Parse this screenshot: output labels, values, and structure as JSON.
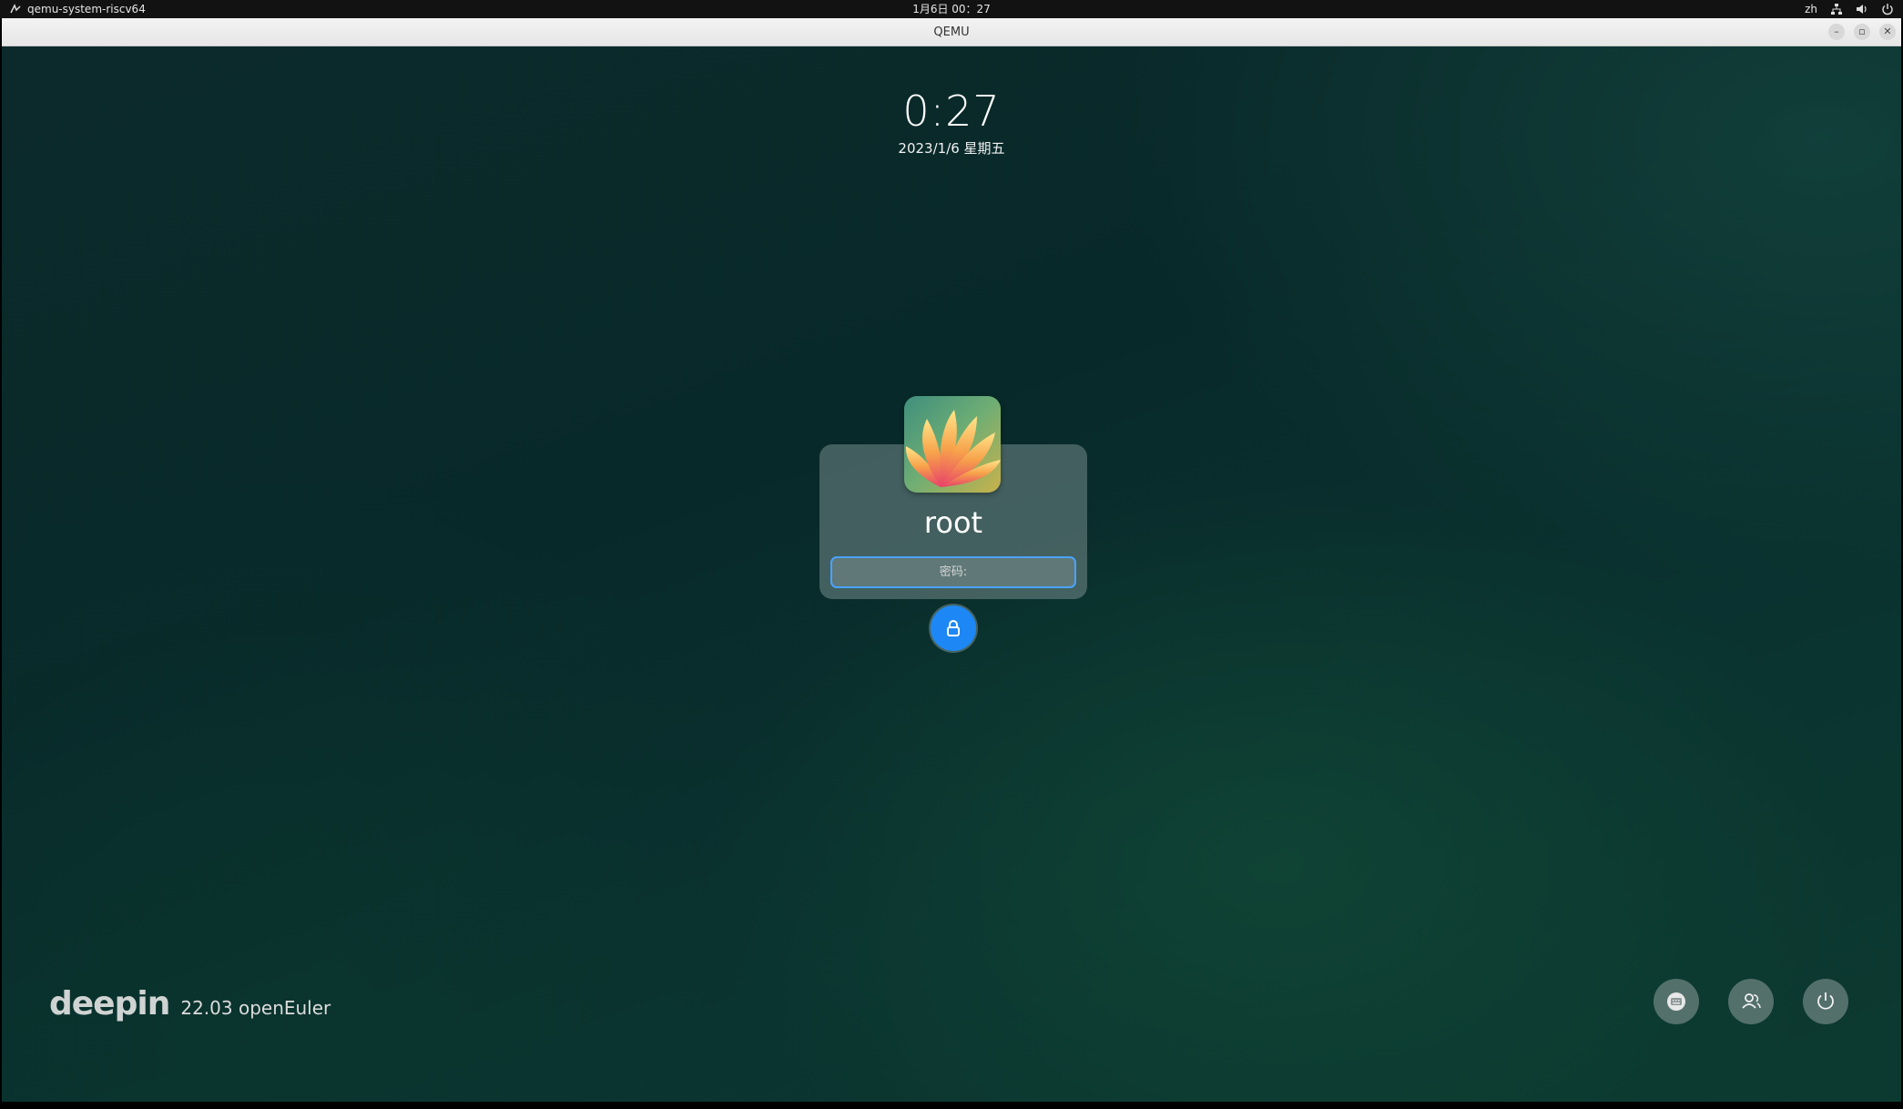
{
  "topbar": {
    "app_name": "qemu-system-riscv64",
    "clock": "1月6日  00：27",
    "language": "zh"
  },
  "window": {
    "title": "QEMU",
    "minimize_label": "–",
    "restore_label": "▫",
    "close_label": "✕"
  },
  "lockscreen": {
    "time": "0:27",
    "date": "2023/1/6 星期五",
    "username": "root",
    "password_placeholder": "密码:",
    "accent_color": "#1d88f5"
  },
  "brand": {
    "logo": "deepin",
    "version": "22.03 openEuler"
  },
  "icons": {
    "app": "qemu-icon",
    "tray": [
      "network-icon",
      "volume-icon",
      "power-icon"
    ],
    "unlock": "lock-icon",
    "bottom": [
      "keyboard-icon",
      "switch-user-icon",
      "power-icon"
    ]
  }
}
